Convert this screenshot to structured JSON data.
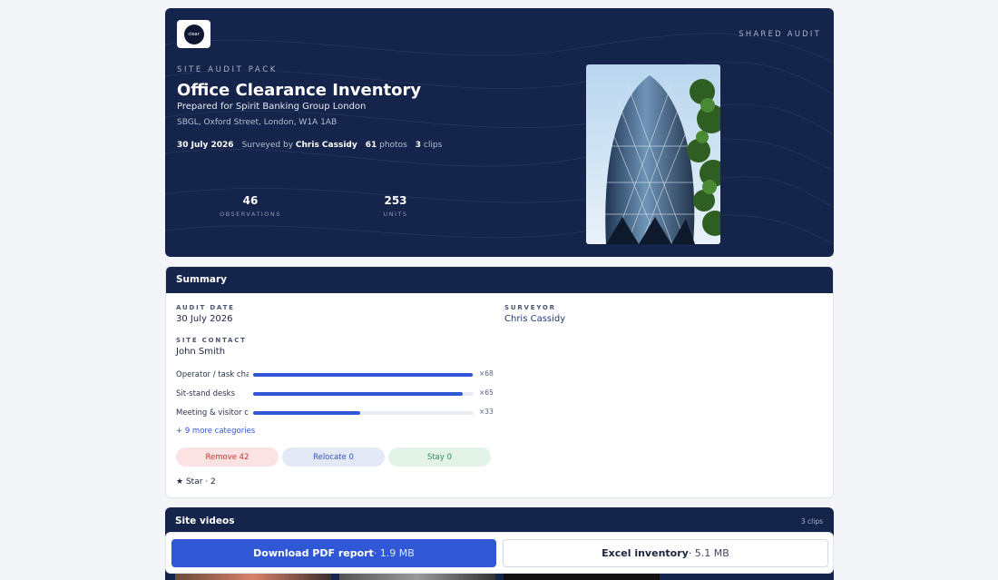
{
  "hero": {
    "logo_text": "clear",
    "shared_label": "SHARED AUDIT",
    "kicker": "SITE AUDIT PACK",
    "title": "Office Clearance Inventory",
    "prepared_for": "Prepared for Spirit Banking Group London",
    "address": "SBGL, Oxford Street, London, W1A 1AB",
    "date": "30 July 2026",
    "surveyed_by_prefix": "Surveyed by",
    "surveyor": "Chris Cassidy",
    "photos_count": "61",
    "photos_label": "photos",
    "clips_count": "3",
    "clips_label": "clips",
    "stats": [
      {
        "value": "46",
        "label": "OBSERVATIONS"
      },
      {
        "value": "253",
        "label": "UNITS"
      }
    ]
  },
  "summary": {
    "heading": "Summary",
    "audit_date_label": "AUDIT DATE",
    "audit_date": "30 July 2026",
    "surveyor_label": "SURVEYOR",
    "surveyor": "Chris Cassidy",
    "site_contact_label": "SITE CONTACT",
    "site_contact": "John Smith",
    "categories": [
      {
        "label": "Operator / task chairs",
        "count": "×68",
        "fraction": 0.995
      },
      {
        "label": "Sit-stand desks",
        "count": "×65",
        "fraction": 0.95
      },
      {
        "label": "Meeting & visitor chairs",
        "count": "×33",
        "fraction": 0.485
      }
    ],
    "more_link": "+ 9 more categories",
    "actions": [
      {
        "label": "Remove 42",
        "bg": "#fbe3e4",
        "fg": "#c0392b"
      },
      {
        "label": "Relocate 0",
        "bg": "#e4e9f8",
        "fg": "#3150b8"
      },
      {
        "label": "Stay 0",
        "bg": "#e3f3e8",
        "fg": "#2e8b57"
      }
    ],
    "star_label": "Star",
    "star_count": "· 2"
  },
  "videos": {
    "heading": "Site videos",
    "count": "3 clips"
  },
  "downloads": {
    "pdf_label": "Download PDF report",
    "pdf_size": "· 1.9 MB",
    "excel_label": "Excel inventory",
    "excel_size": "· 5.1 MB"
  },
  "colors": {
    "navy": "#15244a",
    "accent": "#2f57d6"
  }
}
